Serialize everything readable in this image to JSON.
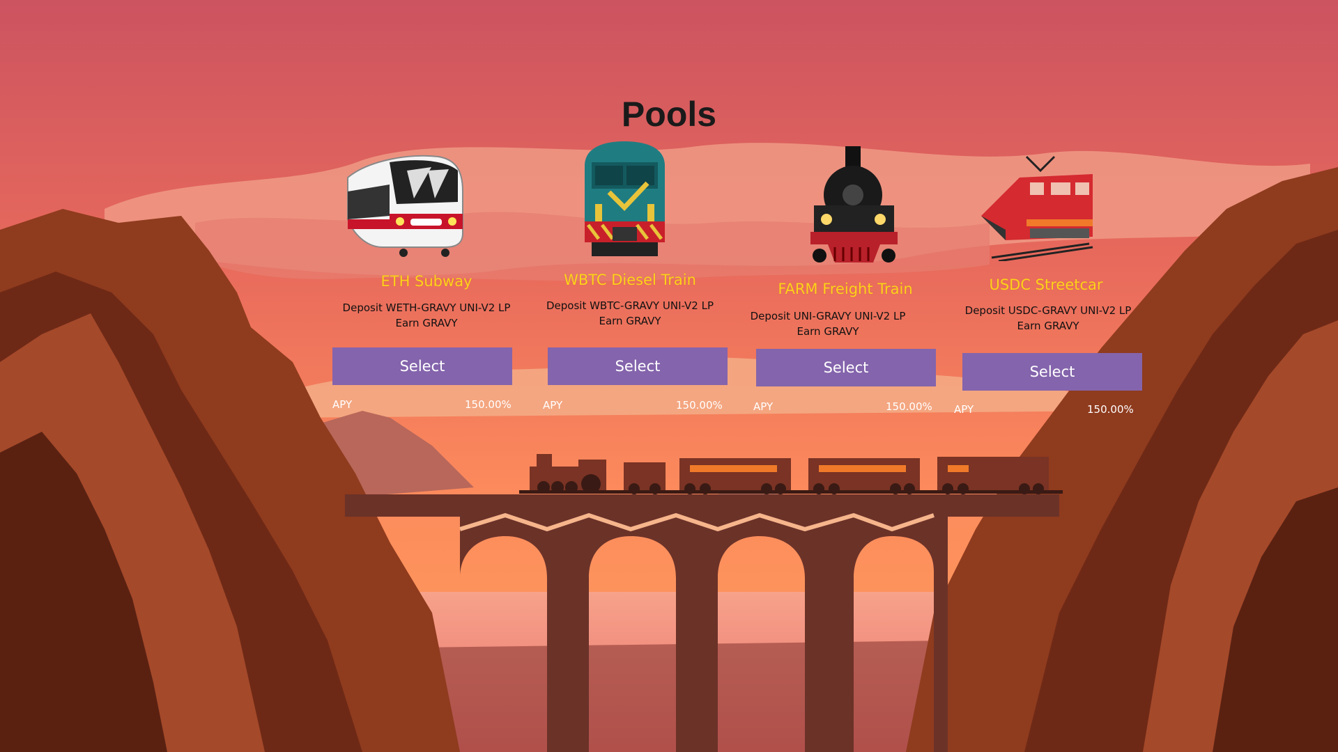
{
  "page": {
    "title": "Pools"
  },
  "pools": [
    {
      "name": "ETH Subway",
      "deposit": "Deposit WETH-GRAVY UNI-V2 LP",
      "earn": "Earn GRAVY",
      "select_label": "Select",
      "apy_label": "APY",
      "apy_value": "150.00%",
      "icon": "subway-train-icon"
    },
    {
      "name": "WBTC Diesel Train",
      "deposit": "Deposit WBTC-GRAVY UNI-V2 LP",
      "earn": "Earn GRAVY",
      "select_label": "Select",
      "apy_label": "APY",
      "apy_value": "150.00%",
      "icon": "diesel-locomotive-icon"
    },
    {
      "name": "FARM Freight Train",
      "deposit": "Deposit UNI-GRAVY UNI-V2 LP",
      "earn": "Earn GRAVY",
      "select_label": "Select",
      "apy_label": "APY",
      "apy_value": "150.00%",
      "icon": "steam-locomotive-icon"
    },
    {
      "name": "USDC Streetcar",
      "deposit": "Deposit USDC-GRAVY UNI-V2 LP",
      "earn": "Earn GRAVY",
      "select_label": "Select",
      "apy_label": "APY",
      "apy_value": "150.00%",
      "icon": "electric-train-icon"
    }
  ],
  "colors": {
    "sky_top": "#cc5360",
    "sky_bottom": "#fe9a5a",
    "button": "#8464ac",
    "pool_name": "#ffd21a",
    "rock": "#8f3b1e",
    "bridge": "#6b3228"
  }
}
